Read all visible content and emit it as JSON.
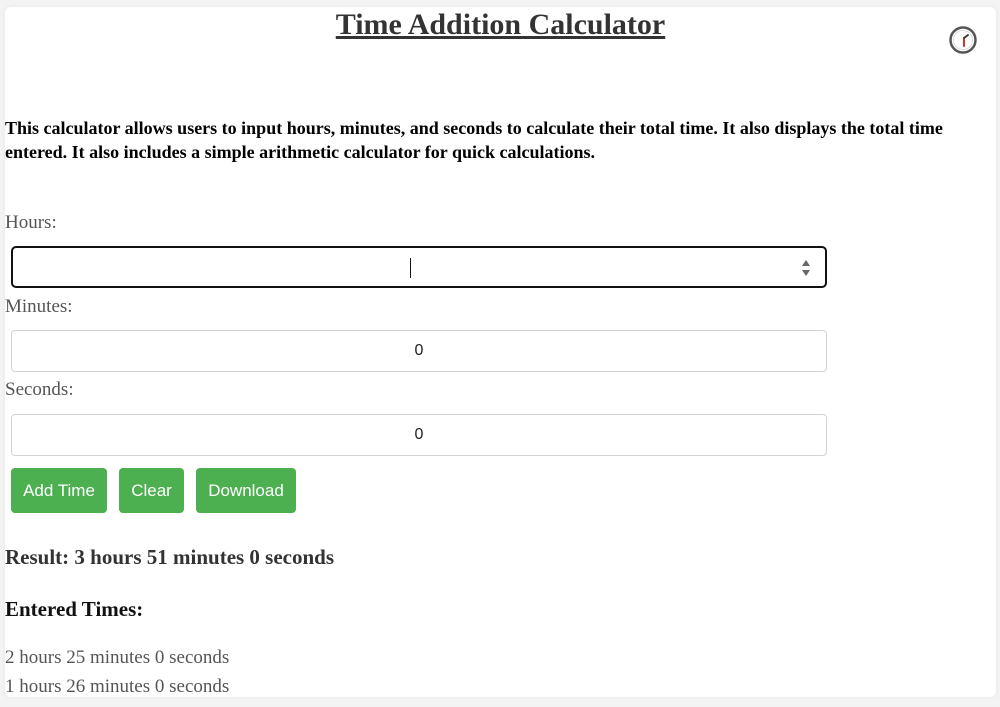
{
  "page": {
    "title": "Time Addition Calculator",
    "description": "This calculator allows users to input hours, minutes, and seconds to calculate their total time. It also displays the total time entered. It also includes a simple arithmetic calculator for quick calculations."
  },
  "form": {
    "hours_label": "Hours:",
    "hours_value": "",
    "minutes_label": "Minutes:",
    "minutes_value": "0",
    "seconds_label": "Seconds:",
    "seconds_value": "0"
  },
  "buttons": {
    "add_time": "Add Time",
    "clear": "Clear",
    "download": "Download"
  },
  "result": {
    "text": "Result: 3 hours 51 minutes 0 seconds"
  },
  "entered": {
    "heading": "Entered Times:",
    "items": [
      "2 hours 25 minutes 0 seconds",
      "1 hours 26 minutes 0 seconds"
    ]
  },
  "icons": {
    "corner": "clock-icon"
  },
  "colors": {
    "button_bg": "#4caf50",
    "button_text": "#ffffff",
    "clock_hand": "#d32f2f"
  }
}
